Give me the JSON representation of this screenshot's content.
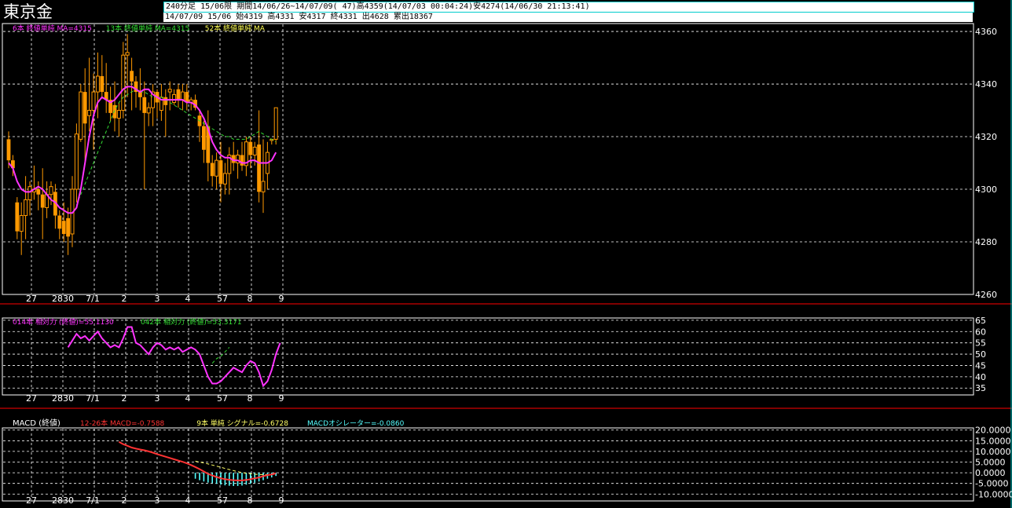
{
  "header": {
    "title": "東京金",
    "info_line1": "240分足 15/06限 期間14/06/26~14/07/09( 47)高4359(14/07/03 00:04:24)安4274(14/06/30 21:13:41)",
    "info_line2": "14/07/09 15/06 始4319 高4331 安4317 終4331 出4628 累出18367"
  },
  "chart_data": [
    {
      "type": "candlestick",
      "legend": [
        {
          "text": "6本 終値単純 MA=4315",
          "color": "#ff33ff"
        },
        {
          "text": "13本 終値単純 MA=4315",
          "color": "#33dd33"
        },
        {
          "text": "52本 終値単純 MA",
          "color": "#ffff55"
        }
      ],
      "y_ticks": [
        4260,
        4280,
        4300,
        4320,
        4340,
        4360
      ],
      "ylim": [
        4260,
        4363
      ],
      "x_tick_labels": [
        "27",
        "2830",
        "7/1",
        "2",
        "3",
        "4",
        "57",
        "8",
        "9"
      ],
      "candles": [
        [
          4319,
          4322,
          4308,
          4311
        ],
        [
          4311,
          4313,
          4305,
          4308
        ],
        [
          4295,
          4297,
          4281,
          4284
        ],
        [
          4284,
          4295,
          4275,
          4290
        ],
        [
          4290,
          4305,
          4281,
          4296
        ],
        [
          4296,
          4303,
          4290,
          4301
        ],
        [
          4299,
          4309,
          4296,
          4300
        ],
        [
          4300,
          4303,
          4292,
          4298
        ],
        [
          4298,
          4308,
          4281,
          4293
        ],
        [
          4293,
          4303,
          4289,
          4298
        ],
        [
          4298,
          4303,
          4294,
          4301
        ],
        [
          4299,
          4302,
          4285,
          4290
        ],
        [
          4290,
          4292,
          4281,
          4285
        ],
        [
          4288,
          4295,
          4280,
          4283
        ],
        [
          4289,
          4293,
          4275,
          4282
        ],
        [
          4283,
          4305,
          4278,
          4300
        ],
        [
          4300,
          4325,
          4295,
          4321
        ],
        [
          4319,
          4340,
          4318,
          4337
        ],
        [
          4337,
          4346,
          4310,
          4325
        ],
        [
          4328,
          4350,
          4322,
          4330
        ],
        [
          4330,
          4344,
          4315,
          4337
        ],
        [
          4337,
          4352,
          4327,
          4343
        ],
        [
          4343,
          4351,
          4335,
          4337
        ],
        [
          4337,
          4348,
          4329,
          4334
        ],
        [
          4334,
          4339,
          4326,
          4329
        ],
        [
          4332,
          4341,
          4322,
          4327
        ],
        [
          4327,
          4333,
          4320,
          4330
        ],
        [
          4330,
          4356,
          4327,
          4351
        ],
        [
          4351,
          4359,
          4335,
          4352
        ],
        [
          4345,
          4350,
          4330,
          4341
        ],
        [
          4341,
          4343,
          4331,
          4337
        ],
        [
          4337,
          4346,
          4330,
          4335
        ],
        [
          4335,
          4341,
          4300,
          4329
        ],
        [
          4329,
          4333,
          4324,
          4331
        ],
        [
          4331,
          4340,
          4324,
          4337
        ],
        [
          4337,
          4338,
          4327,
          4333
        ],
        [
          4330,
          4340,
          4326,
          4335
        ],
        [
          4335,
          4338,
          4320,
          4332
        ],
        [
          4337,
          4341,
          4330,
          4338
        ],
        [
          4333,
          4338,
          4332,
          4336
        ],
        [
          4338,
          4340,
          4331,
          4334
        ],
        [
          4334,
          4340,
          4330,
          4337
        ],
        [
          4337,
          4340,
          4330,
          4333
        ],
        [
          4333,
          4335,
          4330,
          4334
        ],
        [
          4334,
          4336,
          4330,
          4331
        ],
        [
          4328,
          4330,
          4318,
          4324
        ],
        [
          4324,
          4326,
          4310,
          4315
        ],
        [
          4324,
          4330,
          4303,
          4310
        ],
        [
          4310,
          4313,
          4301,
          4305
        ],
        [
          4305,
          4314,
          4300,
          4311
        ],
        [
          4311,
          4318,
          4295,
          4302
        ],
        [
          4302,
          4310,
          4298,
          4306
        ],
        [
          4306,
          4316,
          4298,
          4313
        ],
        [
          4313,
          4318,
          4307,
          4310
        ],
        [
          4310,
          4315,
          4304,
          4313
        ],
        [
          4313,
          4318,
          4307,
          4309
        ],
        [
          4309,
          4320,
          4305,
          4318
        ],
        [
          4318,
          4320,
          4308,
          4313
        ],
        [
          4313,
          4318,
          4309,
          4316
        ],
        [
          4317,
          4330,
          4295,
          4299
        ],
        [
          4299,
          4319,
          4291,
          4303
        ],
        [
          4306,
          4318,
          4300,
          4314
        ],
        [
          4319,
          4319,
          4317,
          4319
        ],
        [
          4319,
          4331,
          4317,
          4331
        ]
      ],
      "ma6": [
        4310,
        4308,
        4303,
        4300,
        4299,
        4299,
        4300,
        4301,
        4300,
        4298,
        4296,
        4295,
        4293,
        4292,
        4291,
        4291,
        4293,
        4300,
        4310,
        4320,
        4328,
        4333,
        4335,
        4334,
        4333,
        4334,
        4336,
        4338,
        4339,
        4339,
        4338,
        4337,
        4338,
        4338,
        4336,
        4335,
        4334,
        4334,
        4334,
        4334,
        4334,
        4334,
        4333,
        4333,
        4332,
        4330,
        4327,
        4323,
        4318,
        4315,
        4313,
        4312,
        4312,
        4311,
        4311,
        4310,
        4310,
        4311,
        4311,
        4310,
        4310,
        4310,
        4311,
        4314
      ],
      "ma13": {
        "start": 16,
        "values": [
          4294,
          4298,
          4302,
          4306,
          4310,
          4314,
          4318,
          4322,
          4326,
          4330,
          4333,
          4335,
          4336,
          4337,
          4338,
          4337,
          4337,
          4336,
          4335,
          4335,
          4335,
          4334,
          4333,
          4332,
          4331,
          4330,
          4329,
          4328,
          4327,
          4326,
          4325,
          4324,
          4323,
          4322,
          4321,
          4320,
          4320,
          4319,
          4319,
          4319,
          4319,
          4320,
          4321,
          4322,
          4321,
          4320,
          4319,
          4318
        ]
      }
    },
    {
      "type": "line",
      "legend": [
        {
          "text": "014本 相対力 (終値)=55.1130",
          "color": "#ff33ff"
        },
        {
          "text": "042本 相対力 (終値)=53.3171",
          "color": "#33dd33"
        }
      ],
      "y_ticks": [
        35,
        40,
        45,
        50,
        55,
        60,
        65
      ],
      "ylim": [
        33,
        66
      ],
      "x_tick_labels": [
        "27",
        "2830",
        "7/1",
        "2",
        "3",
        "4",
        "57",
        "8",
        "9"
      ],
      "rsi14": {
        "start": 14,
        "values": [
          53,
          56,
          59,
          57,
          58,
          56,
          58,
          60,
          57,
          55,
          53,
          54,
          53,
          57,
          62,
          62,
          55,
          54,
          52,
          50,
          53,
          55,
          54,
          52,
          53,
          52,
          53,
          51,
          52,
          53,
          52,
          50,
          45,
          40,
          37,
          37,
          38,
          40,
          42,
          44,
          43,
          42,
          45,
          47,
          46,
          42,
          36,
          38,
          43,
          50,
          55
        ]
      },
      "rsi42": {
        "start": 48,
        "values": [
          46,
          48,
          49,
          51,
          53
        ]
      }
    },
    {
      "type": "line",
      "title": "MACD (終値)",
      "legend": [
        {
          "text": "12-26本 MACD=-0.7588",
          "color": "#ff3333"
        },
        {
          "text": "9本 単純 シグナル=-0.6728",
          "color": "#ffff66"
        },
        {
          "text": "MACDオシレーター=-0.0860",
          "color": "#55ffff"
        }
      ],
      "y_ticks": [
        "20.0000",
        "15.0000",
        "10.0000",
        "5.0000",
        "0.0000",
        "-5.0000",
        "-10.0000"
      ],
      "ylim": [
        -11,
        21
      ],
      "x_tick_labels": [
        "27",
        "2830",
        "7/1",
        "2",
        "3",
        "4",
        "57",
        "8",
        "9"
      ],
      "macd": {
        "start": 26,
        "values": [
          14.5,
          13.4,
          12.6,
          11.8,
          11.3,
          10.9,
          10.5,
          10.0,
          9.4,
          8.7,
          8.1,
          7.5,
          6.9,
          6.3,
          5.7,
          5.1,
          4.4,
          3.6,
          2.7,
          1.7,
          0.6,
          -0.5,
          -1.3,
          -2.0,
          -2.6,
          -3.0,
          -3.3,
          -3.5,
          -3.6,
          -3.6,
          -3.4,
          -3.0,
          -2.6,
          -2.2,
          -1.6,
          -1.1,
          -0.8,
          -0.3
        ]
      },
      "signal": {
        "start": 44,
        "values": [
          5.4,
          5.0,
          4.6,
          4.1,
          3.6,
          3.1,
          2.6,
          2.0,
          1.5,
          1.0,
          0.5,
          0.1,
          -0.3,
          -0.5,
          -0.7,
          -0.8,
          -0.9,
          -0.9,
          -0.8,
          -0.7
        ]
      },
      "oscillator": {
        "start": 44,
        "values": [
          -2.8,
          -3.5,
          -4.1,
          -4.6,
          -4.9,
          -5.2,
          -5.6,
          -5.9,
          -6.1,
          -6.2,
          -6.2,
          -6.0,
          -5.6,
          -5.2,
          -4.7,
          -4.1,
          -3.5,
          -2.8,
          -2.2,
          -1.5
        ]
      }
    }
  ],
  "colors": {
    "up_candle": "#ff9900",
    "down_candle": "#ff9900",
    "wick": "#ff9900",
    "grid": "#ffffff",
    "panel_border": "#ffffff",
    "separator": "#ff0000",
    "axis_text": "#ffffff"
  }
}
